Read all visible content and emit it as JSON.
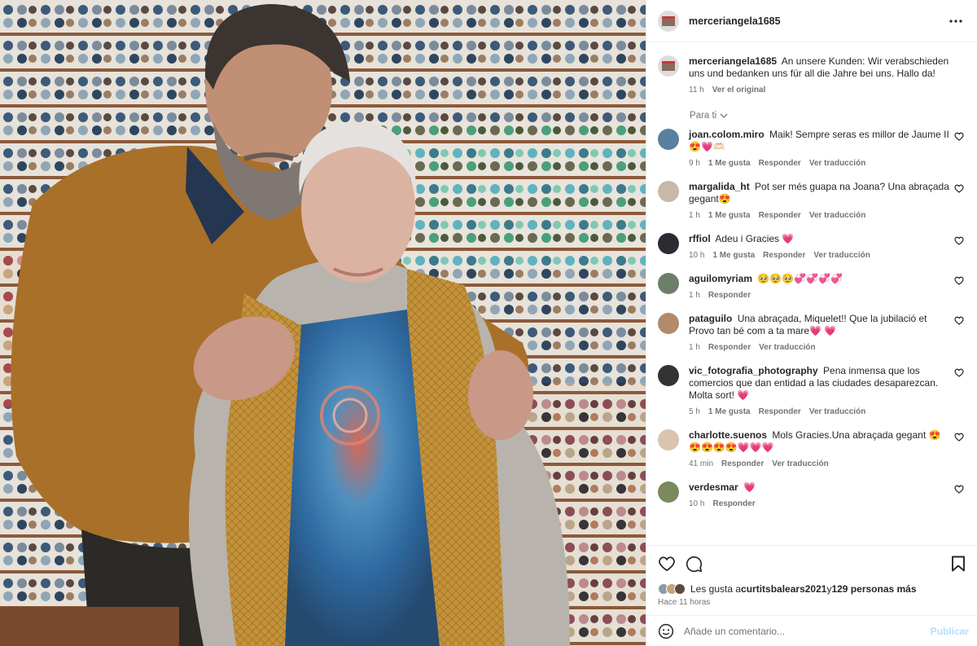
{
  "post": {
    "username": "merceriangela1685",
    "caption": "An unsere Kunden: Wir verabschieden uns und bedanken uns für all die Jahre bei uns. Hallo da!",
    "caption_time": "11 h",
    "see_original": "Ver el original",
    "para_ti": "Para ti"
  },
  "comments": [
    {
      "user": "joan.colom.miro",
      "text": "Maik! Sempre seras es millor de Jaume II😍💗🫶🏻",
      "time": "9 h",
      "likes": "1 Me gusta",
      "reply": "Responder",
      "translate": "Ver traducción",
      "avatar": "#5a7fa0"
    },
    {
      "user": "margalida_ht",
      "text": "Pot ser més guapa na Joana? Una abraçada gegant😍",
      "time": "1 h",
      "likes": "1 Me gusta",
      "reply": "Responder",
      "translate": "Ver traducción",
      "avatar": "#c9b8a8"
    },
    {
      "user": "rffiol",
      "text": "Adeu i Gracies 💗",
      "time": "10 h",
      "likes": "1 Me gusta",
      "reply": "Responder",
      "translate": "Ver traducción",
      "avatar": "#2c2a33"
    },
    {
      "user": "aguilomyriam",
      "text": "🥹🥹🥹💞💞💞💞",
      "time": "1 h",
      "likes": "",
      "reply": "Responder",
      "translate": "",
      "avatar": "#6d7f6a"
    },
    {
      "user": "pataguilo",
      "text": "Una abraçada, Miquelet!! Que la jubilació et Provo tan bé com a ta mare💗 💗",
      "time": "1 h",
      "likes": "",
      "reply": "Responder",
      "translate": "Ver traducción",
      "avatar": "#b38a6a"
    },
    {
      "user": "vic_fotografia_photography",
      "text": "Pena inmensa que los comercios que dan entidad a las ciudades desaparezcan. Molta sort! 💗",
      "time": "5 h",
      "likes": "1 Me gusta",
      "reply": "Responder",
      "translate": "Ver traducción",
      "avatar": "#333333"
    },
    {
      "user": "charlotte.suenos",
      "text": "Mols Gracies.Una abraçada gegant 😍😍😍😍😍💗💗💗",
      "time": "41 min",
      "likes": "",
      "reply": "Responder",
      "translate": "Ver traducción",
      "avatar": "#d9c4b0"
    },
    {
      "user": "verdesmar",
      "text": "💗",
      "time": "10 h",
      "likes": "",
      "reply": "Responder",
      "translate": "",
      "avatar": "#7a8a5c"
    }
  ],
  "likes": {
    "prefix": "Les gusta a ",
    "user": "curtitsbalears2021",
    "middle": " y ",
    "others": "129 personas más",
    "ago": "Hace 11 horas"
  },
  "composer": {
    "placeholder": "Añade un comentario...",
    "publish": "Publicar"
  },
  "icons": {
    "more": "more-horizontal-icon",
    "like": "heart-icon",
    "comment": "comment-icon",
    "save": "bookmark-icon",
    "emoji": "emoji-icon",
    "chevron": "chevron-down-icon"
  },
  "colors": {
    "text": "#262626",
    "muted": "#737373",
    "publish": "#b2dffc",
    "sweater": "#a9702a",
    "vest": "#c4923a"
  }
}
